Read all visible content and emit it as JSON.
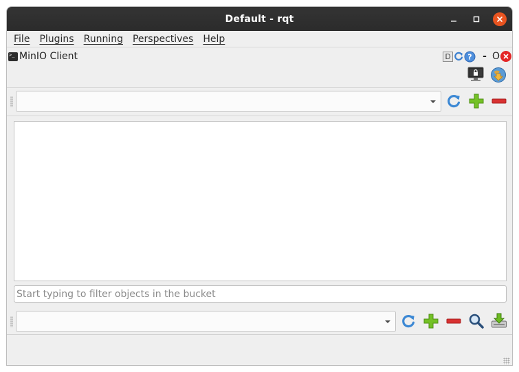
{
  "window": {
    "title": "Default - rqt",
    "controls": {
      "minimize_icon": "minimize-icon",
      "maximize_icon": "maximize-icon",
      "close_icon": "close-icon",
      "close_color": "#e95420"
    }
  },
  "menubar": {
    "items": [
      {
        "label": "File"
      },
      {
        "label": "Plugins"
      },
      {
        "label": "Running"
      },
      {
        "label": "Perspectives"
      },
      {
        "label": "Help"
      }
    ]
  },
  "plugin": {
    "title": "MinIO Client",
    "icon": "terminal-icon",
    "header_buttons": {
      "d_label": "D",
      "dash_label": "-",
      "o_label": "O",
      "reload_icon": "reload-icon",
      "help_icon": "help-icon",
      "close_icon": "close-icon"
    },
    "top_icons": [
      "lock-monitor-icon",
      "globe-download-icon"
    ]
  },
  "bucket_toolbar": {
    "selected_value": "",
    "icons": [
      "refresh-icon",
      "add-icon",
      "remove-icon"
    ]
  },
  "objects": [],
  "filter": {
    "value": "",
    "placeholder": "Start typing to filter objects in the bucket"
  },
  "object_toolbar": {
    "selected_value": "",
    "icons": [
      "refresh-icon",
      "add-icon",
      "remove-icon",
      "search-icon",
      "download-icon"
    ]
  },
  "colors": {
    "titlebar": "#2b2b2b",
    "accent_close": "#e95420",
    "refresh_blue": "#3c88d4",
    "add_green": "#6dbb21",
    "remove_red": "#d93232"
  }
}
